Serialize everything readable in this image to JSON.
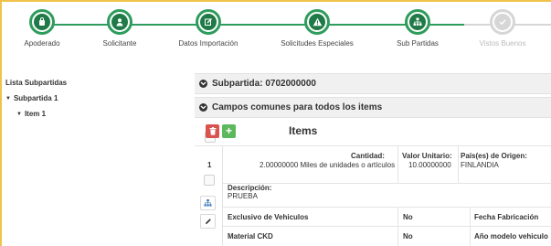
{
  "stepper": {
    "steps": [
      {
        "label": "Apoderado",
        "icon": "bag-icon",
        "state": "done"
      },
      {
        "label": "Solicitante",
        "icon": "person-icon",
        "state": "done"
      },
      {
        "label": "Datos Importación",
        "icon": "edit-icon",
        "state": "done"
      },
      {
        "label": "Solicitudes Especiales",
        "icon": "warning-icon",
        "state": "done"
      },
      {
        "label": "Sub Partidas",
        "icon": "sitemap-icon",
        "state": "done"
      },
      {
        "label": "Vistos Buenos",
        "icon": "check-icon",
        "state": "disabled"
      }
    ],
    "colors": {
      "active": "#2e9c5c",
      "inactive": "#d6d6d6"
    }
  },
  "tree": {
    "title": "Lista Subpartidas",
    "nodes": [
      {
        "label": "Subpartida 1"
      },
      {
        "label": "Item 1"
      }
    ]
  },
  "main": {
    "subpartida_header": "Subpartida: 0702000000",
    "common_fields_header": "Campos comunes para todos los items",
    "items_title": "Items",
    "add_label": "+",
    "row": {
      "number": "1",
      "cantidad_label": "Cantidad:",
      "cantidad_value": "2.00000000 Miles de unidades o artículos",
      "valor_label": "Valor Unitario:",
      "valor_value": "10.00000000",
      "pais_label": "País(es) de Origen:",
      "pais_value": "FINLANDIA",
      "descripcion_label": "Descripción:",
      "descripcion_value": "PRUEBA",
      "exclusivo_label": "Exclusivo de Vehiculos",
      "exclusivo_value": "No",
      "fecha_label": "Fecha Fabricación",
      "material_label": "Material CKD",
      "material_value": "No",
      "anio_label": "Año modelo vehiculo"
    }
  }
}
